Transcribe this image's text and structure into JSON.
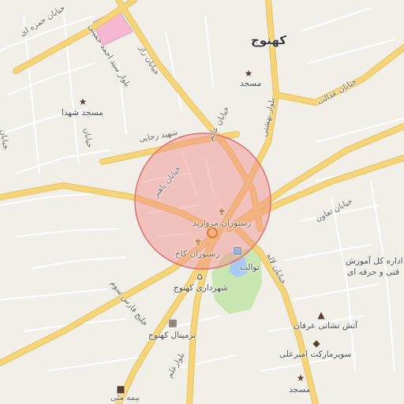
{
  "map": {
    "city_label": "کهنوج",
    "accent_circle_color": "#f08a8a",
    "road_color": "#f6d57a",
    "park_color": "#c8e6b0",
    "water_color": "#a9c9f2",
    "pink_area_color": "#f6b7d0"
  },
  "roads": {
    "top_left": "خیابان حمزه ای",
    "asad": "بلوار سید احمد خمینی",
    "raz": "خیابان راز",
    "edalat": "خیابان عدالت",
    "beheshti": "بلوار بهشتی",
    "alam": "خیابان عالم",
    "shahid_rajayi": "شهید رجایی",
    "bahonar": "خیابان باهنر",
    "taavon": "خیابان تعاون",
    "lale": "خیابان لاله",
    "faris": "خلیج فارس سوم",
    "baljan": "خیابان",
    "bottom_boulevard": "بلوارعلم",
    "bottom_left": "بیمه ملی",
    "left_edge": "خیابان"
  },
  "pois": {
    "mosque_top": "مسجد",
    "mosque_shohada": "مسجد شهدا",
    "restaurant_morvarid": "رستوران مروارید",
    "restaurant_kakh": "رستوران کاخ",
    "toilet": "توالت",
    "municipality": "شهرداری کهنوج",
    "terminal": "ترمینال کهنوج",
    "fire_station": "آتش نشانی عرفان",
    "supermarket": "سوپرمارکت امیرعلی",
    "mosque_bottom": "مسجد",
    "education_line1": "اداره کل آموزش",
    "education_line2": "فنی و حرفه ای"
  },
  "icons": {
    "mosque": "mosque-icon",
    "restaurant": "restaurant-icon",
    "municipality": "municipality-icon",
    "bus": "bus-icon",
    "fuel": "fuel-icon",
    "toilet": "toilet-icon"
  }
}
